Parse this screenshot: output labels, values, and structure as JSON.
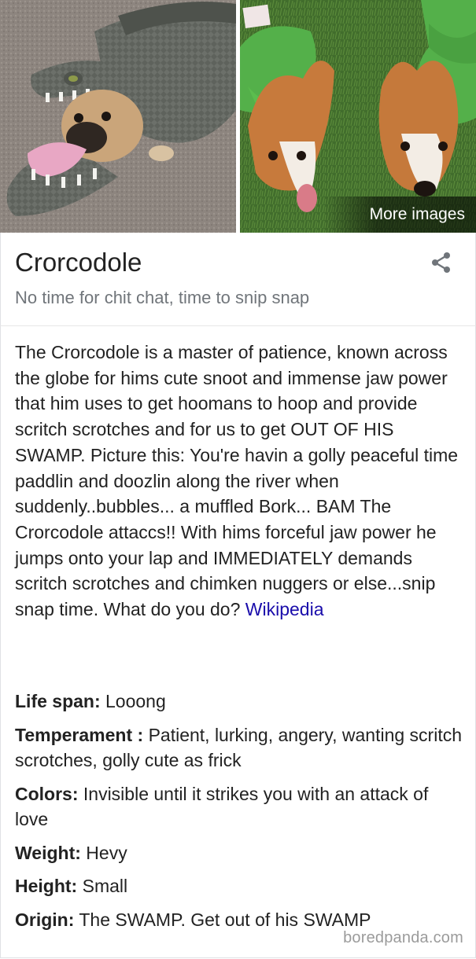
{
  "images": {
    "more_images_label": "More images"
  },
  "panel": {
    "title": "Crorcodole",
    "subtitle": "No time for chit chat, time to snip snap",
    "share_icon": "share-icon"
  },
  "description": {
    "text": "The Crorcodole is a master of patience, known across the globe for hims cute snoot and immense jaw power that him uses to get hoomans to hoop and provide scritch scrotches and for us to get OUT OF HIS SWAMP. Picture this: You're havin a golly peaceful time paddlin and doozlin along the river when suddenly..bubbles... a muffled Bork... BAM The Crorcodole attaccs!! With hims forceful jaw power he jumps onto your lap and IMMEDIATELY demands scritch scrotches and chimken nuggers or else...snip snap time. What do you do? ",
    "source_link": "Wikipedia"
  },
  "facts": [
    {
      "label": "Life span:",
      "value": "Looong"
    },
    {
      "label": "Temperament :",
      "value": "Patient, lurking, angery, wanting scritch scrotches, golly cute as frick"
    },
    {
      "label": "Colors:",
      "value": "Invisible until it strikes you with an attack of love"
    },
    {
      "label": "Weight:",
      "value": "Hevy"
    },
    {
      "label": "Height:",
      "value": "Small"
    },
    {
      "label": "Origin:",
      "value": "The SWAMP. Get out of his SWAMP"
    }
  ],
  "watermark": "boredpanda.com",
  "colors": {
    "link": "#1a0dab",
    "subtitle": "#70757a",
    "text": "#222222"
  }
}
